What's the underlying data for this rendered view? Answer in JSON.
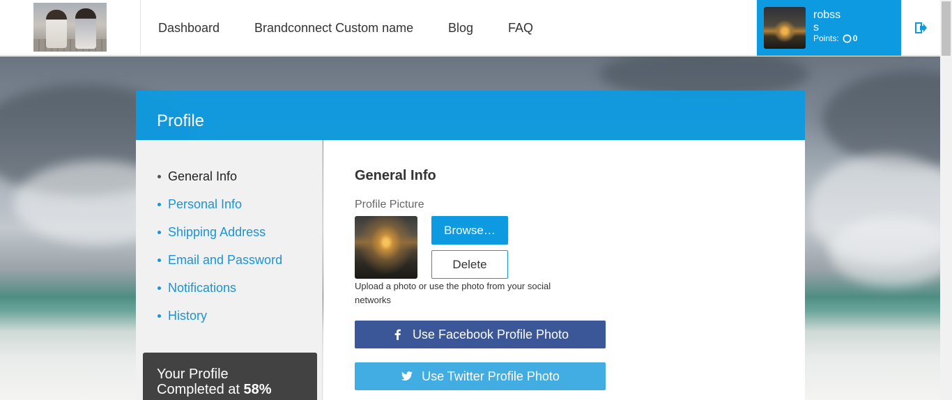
{
  "header": {
    "nav": [
      {
        "label": "Dashboard"
      },
      {
        "label": "Brandconnect Custom name"
      },
      {
        "label": "Blog"
      },
      {
        "label": "FAQ"
      }
    ],
    "user": {
      "first_name": "robss",
      "last_name": "s",
      "points_label": "Points:",
      "points_value": "0"
    },
    "logout_icon": "logout-icon"
  },
  "profile": {
    "title": "Profile",
    "sidebar": {
      "items": [
        {
          "label": "General Info",
          "active": true
        },
        {
          "label": "Personal Info",
          "active": false
        },
        {
          "label": "Shipping Address",
          "active": false
        },
        {
          "label": "Email and Password",
          "active": false
        },
        {
          "label": "Notifications",
          "active": false
        },
        {
          "label": "History",
          "active": false
        }
      ],
      "completion": {
        "line1": "Your Profile",
        "line2_prefix": "Completed at",
        "percent": "58%"
      }
    },
    "general": {
      "title": "General Info",
      "picture_label": "Profile Picture",
      "browse_label": "Browse…",
      "delete_label": "Delete",
      "upload_hint": "Upload a photo or use the photo from your social networks",
      "facebook_label": "Use Facebook Profile Photo",
      "twitter_label": "Use Twitter Profile Photo"
    }
  },
  "colors": {
    "accent": "#0e9ae0",
    "facebook": "#3b5798",
    "twitter": "#41ade2",
    "completion_bg": "#424242"
  }
}
